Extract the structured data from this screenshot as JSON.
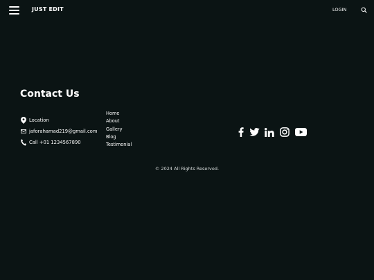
{
  "header": {
    "brand": "JUST EDIT",
    "login_label": "LOGIN",
    "menu_icon": "hamburger-menu-icon",
    "search_icon": "search-icon"
  },
  "contact": {
    "title": "Contact Us",
    "location": "Location",
    "email": "jaforahamad219@gmail.com",
    "phone": "Call +01 1234567890"
  },
  "links": [
    "Home",
    "About",
    "Gallery",
    "Blog",
    "Testimonial"
  ],
  "social": [
    "facebook-icon",
    "twitter-icon",
    "linkedin-icon",
    "instagram-icon",
    "youtube-icon"
  ],
  "footer": {
    "copyright": "© 2024 All Rights Reserved."
  },
  "colors": {
    "background": "#0b1414",
    "text": "#ffffff"
  }
}
